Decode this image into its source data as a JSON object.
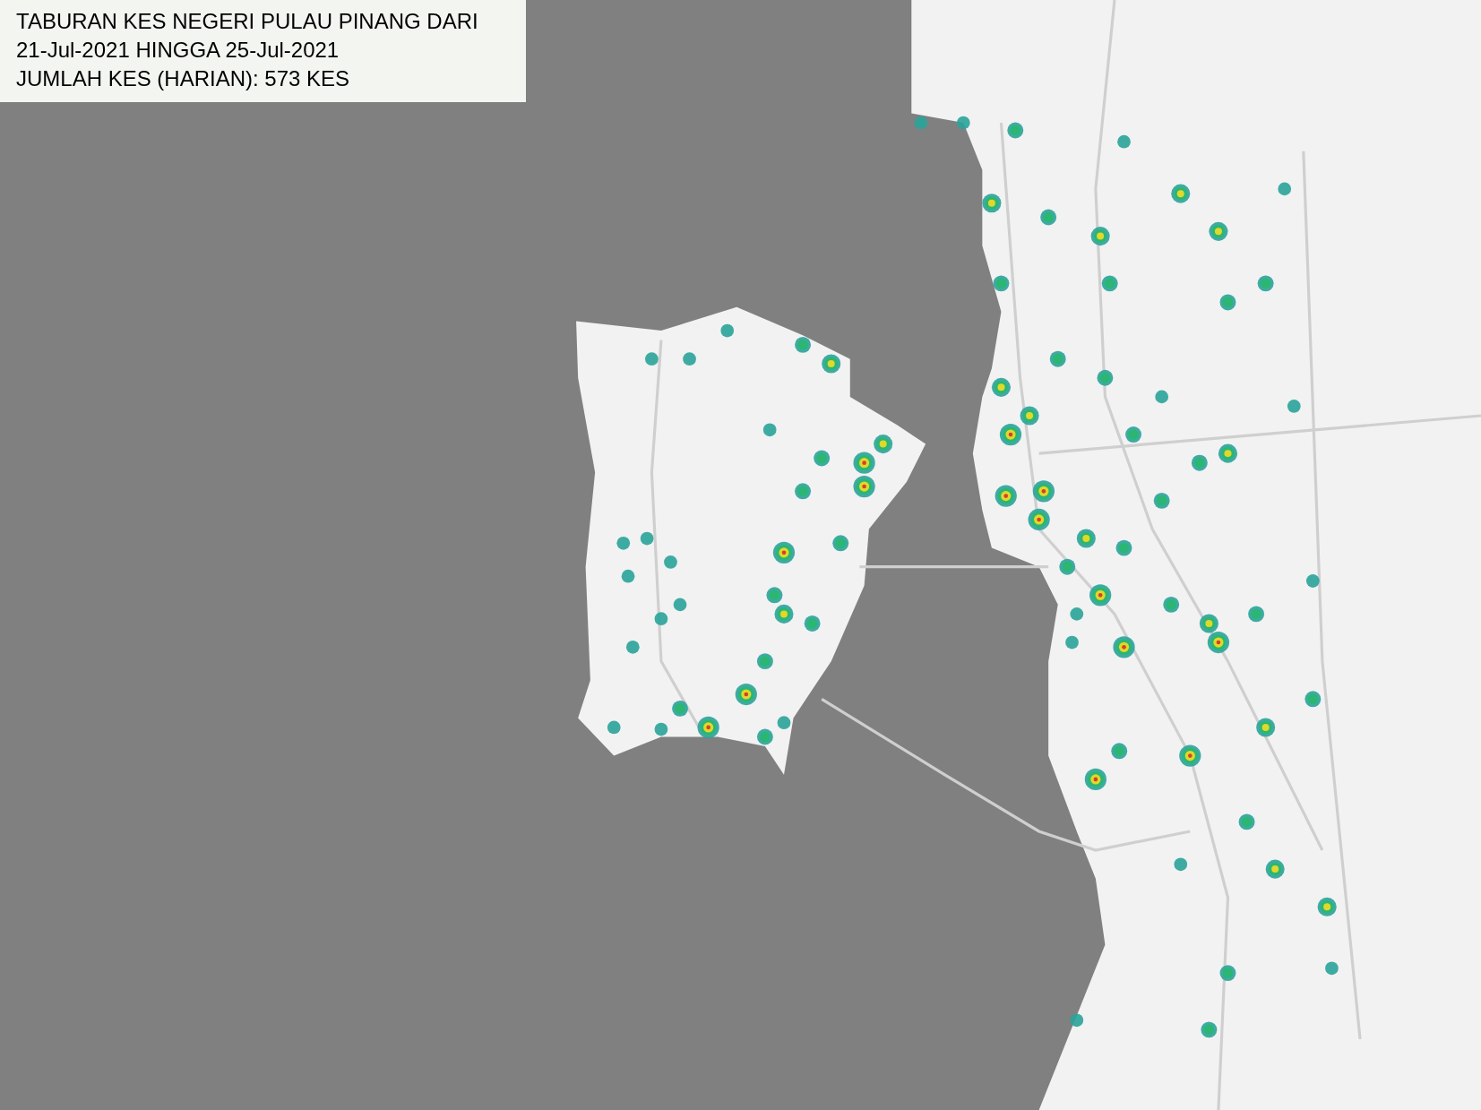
{
  "title_lines": [
    "TABURAN KES NEGERI PULAU PINANG DARI",
    "21-Jul-2021 HINGGA 25-Jul-2021",
    "JUMLAH KES (HARIAN): 573 KES"
  ]
}
